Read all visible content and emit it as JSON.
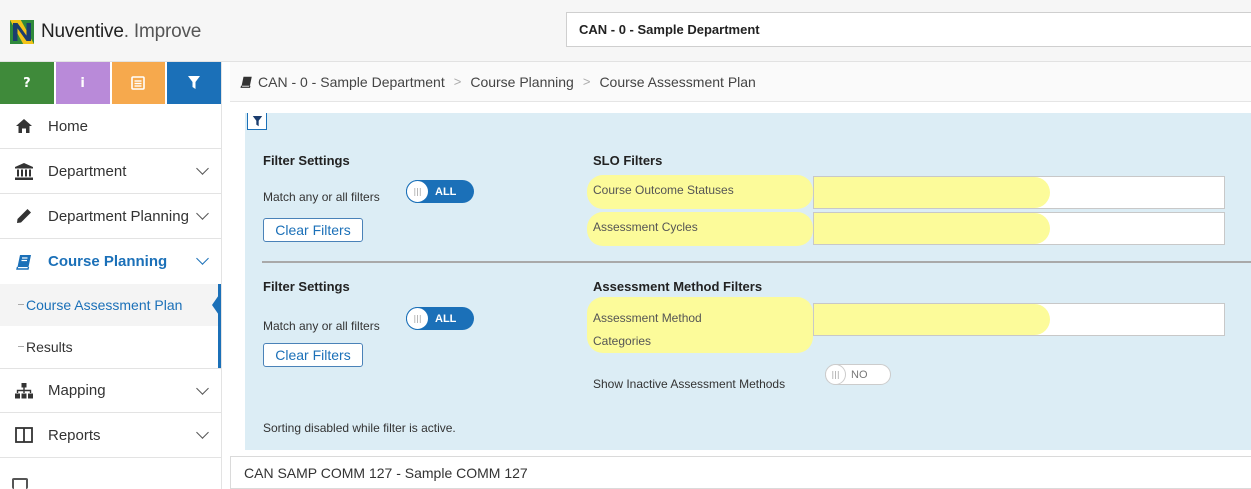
{
  "app": {
    "brand": "Nuventive",
    "product": "Improve",
    "department_selector": "CAN - 0 - Sample Department"
  },
  "toolbar": {
    "help_label": "?",
    "info_label": "i",
    "doc_icon": "document-icon",
    "filter_icon": "funnel-icon"
  },
  "sidebar": {
    "items": [
      {
        "label": "Home",
        "icon": "home-icon"
      },
      {
        "label": "Department",
        "icon": "bank-icon"
      },
      {
        "label": "Department Planning",
        "icon": "pencil-icon"
      },
      {
        "label": "Course Planning",
        "icon": "book-icon"
      },
      {
        "label": "Mapping",
        "icon": "sitemap-icon"
      },
      {
        "label": "Reports",
        "icon": "columns-icon"
      }
    ],
    "subitems": [
      {
        "label": "Course Assessment Plan"
      },
      {
        "label": "Results"
      }
    ]
  },
  "breadcrumb": {
    "items": [
      "CAN - 0 - Sample Department",
      "Course Planning",
      "Course Assessment Plan"
    ],
    "separator": ">"
  },
  "filters": {
    "slo_group": {
      "settings_title": "Filter Settings",
      "match_label": "Match any or all filters",
      "toggle_value": "ALL",
      "clear_label": "Clear Filters",
      "title": "SLO Filters",
      "fields": [
        {
          "label": "Course Outcome Statuses",
          "value": ""
        },
        {
          "label": "Assessment Cycles",
          "value": ""
        }
      ]
    },
    "method_group": {
      "settings_title": "Filter Settings",
      "match_label": "Match any or all filters",
      "toggle_value": "ALL",
      "clear_label": "Clear Filters",
      "title": "Assessment Method Filters",
      "fields": [
        {
          "label_line1": "Assessment Method",
          "label_line2": "Categories",
          "value": ""
        }
      ],
      "inactive_label": "Show Inactive Assessment Methods",
      "inactive_toggle": "NO"
    },
    "sort_note": "Sorting disabled while filter is active."
  },
  "course": {
    "title": "CAN SAMP COMM 127 - Sample COMM 127"
  },
  "colors": {
    "accent": "#1b70b8",
    "panel": "#dcedf5",
    "highlight": "#fcfb9a",
    "help": "#3f8a3a",
    "info": "#b98ad9",
    "doc": "#f6a94d"
  }
}
